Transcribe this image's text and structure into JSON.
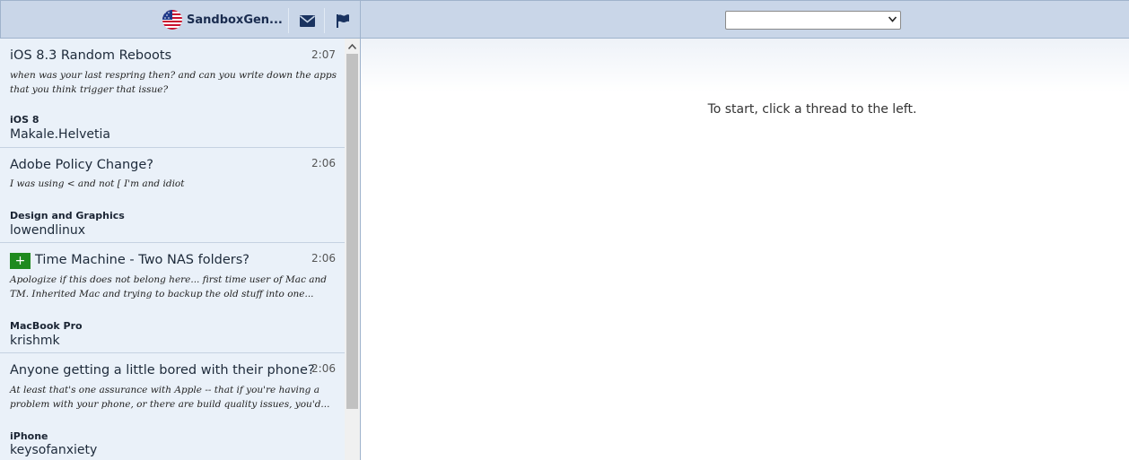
{
  "header": {
    "username": "SandboxGen...",
    "icons": [
      "us-flag-avatar-icon",
      "envelope-icon",
      "flag-icon"
    ]
  },
  "threads": [
    {
      "title": "iOS 8.3 Random Reboots",
      "time": "2:07",
      "snippet": "when was your last respring then? and can you write down the apps that you think trigger that issue?",
      "forum": "iOS 8",
      "author": "Makale.Helvetia"
    },
    {
      "title": "Adobe Policy Change?",
      "time": "2:06",
      "snippet": "I was using < and not [ I'm and idiot",
      "forum": "Design and Graphics",
      "author": "lowendlinux"
    },
    {
      "title": "Time Machine - Two NAS folders?",
      "time": "2:06",
      "badge": "+",
      "snippet": "Apologize if this does not belong here... first time user of Mac and TM. Inherited Mac and trying to backup the old stuff into one...",
      "forum": "MacBook Pro",
      "author": "krishmk"
    },
    {
      "title": "Anyone getting a little bored with their phone?",
      "time": "2:06",
      "snippet": "At least that's one assurance with Apple -- that if you're having a problem with your phone, or there are build quality issues, you'd...",
      "forum": "iPhone",
      "author": "keysofanxiety"
    }
  ],
  "forum_select": {
    "value": ""
  },
  "main": {
    "start_message": "To start, click a thread to the left."
  },
  "colors": {
    "header_bg": "#c9d6e8",
    "list_bg": "#eaf1f9",
    "badge_green": "#1f8a1f"
  }
}
